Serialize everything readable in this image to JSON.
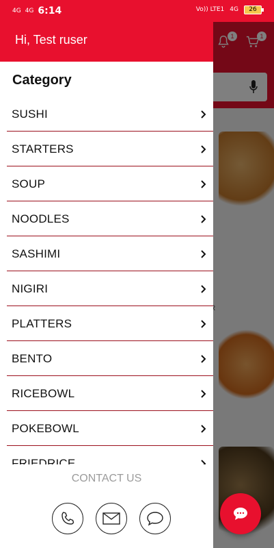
{
  "status_bar": {
    "network_left_1": "4G",
    "network_left_2": "4G",
    "time": "6:14",
    "volte": "Vo)) LTE1",
    "network_right": "4G",
    "battery": "26"
  },
  "app": {
    "bell_badge": "1",
    "cart_badge": "1",
    "visible_text_fragment": "ER"
  },
  "drawer": {
    "greeting": "Hi, Test  ruser",
    "category_title": "Category",
    "categories": [
      {
        "label": "SUSHI"
      },
      {
        "label": "STARTERS"
      },
      {
        "label": "SOUP"
      },
      {
        "label": "NOODLES"
      },
      {
        "label": "SASHIMI"
      },
      {
        "label": "NIGIRI"
      },
      {
        "label": "PLATTERS"
      },
      {
        "label": "BENTO"
      },
      {
        "label": "RICEBOWL"
      },
      {
        "label": "POKEBOWL"
      },
      {
        "label": "FRIEDRICE"
      }
    ],
    "contact_label": "CONTACT US",
    "contact_icons": [
      "phone-icon",
      "mail-icon",
      "chat-icon"
    ]
  },
  "colors": {
    "brand_red": "#e8102e",
    "divider_red": "#9b0f1c",
    "contact_gray": "#9b9b9b"
  }
}
